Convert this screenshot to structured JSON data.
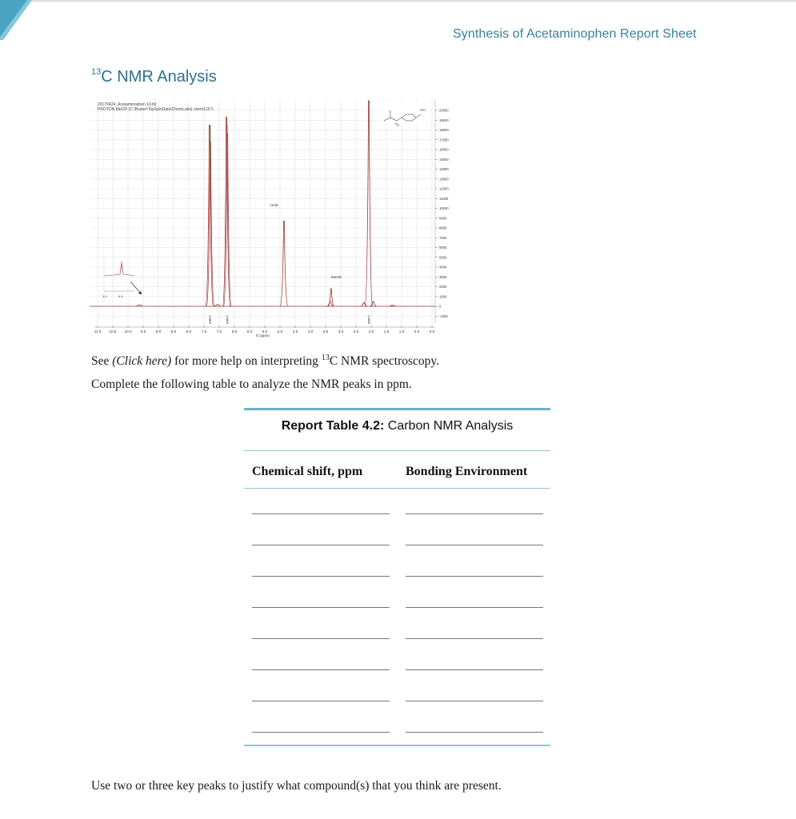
{
  "header": {
    "title": "Synthesis of Acetaminophen Report Sheet"
  },
  "section": {
    "title_sup": "13",
    "title_text": "C NMR Analysis"
  },
  "spectrum": {
    "file_line": "20170424_Acetaminophen 10.fid",
    "params_line": "PROTON MeOD {C:\\Bruker\\TopSpinData\\ChemLabs} chem129 5",
    "solvent_labels": {
      "hod": "HOD",
      "meod": "MeOD"
    },
    "structure_label": "OH",
    "structure_nh": "H",
    "inset_ticks": [
      "1.0",
      "9.5"
    ],
    "xaxis_title": "f1 (ppm)",
    "colors": {
      "trace": "#a03030",
      "integral": "#5a8a2a",
      "integral_text": "#3a3aa0",
      "grid": "#e2e2e2"
    }
  },
  "chart_data": {
    "type": "line",
    "title": "20170424_Acetaminophen 10.fid — PROTON MeOD",
    "xlabel": "f1 (ppm)",
    "ylabel": "",
    "xlim": [
      11.0,
      0.0
    ],
    "ylim": [
      -1000,
      20000
    ],
    "grid": true,
    "x_ticks": [
      "11.0",
      "10.5",
      "10.0",
      "9.5",
      "9.0",
      "8.5",
      "8.0",
      "7.5",
      "7.0",
      "6.5",
      "6.0",
      "5.5",
      "5.0",
      "4.5",
      "4.0",
      "3.5",
      "3.0",
      "2.5",
      "2.0",
      "1.5",
      "1.0",
      "0.5",
      "0.0"
    ],
    "y_ticks": [
      "20000",
      "19000",
      "18000",
      "17000",
      "16000",
      "15000",
      "14000",
      "13000",
      "12000",
      "11000",
      "10000",
      "9000",
      "8000",
      "7000",
      "6000",
      "5000",
      "4000",
      "3000",
      "2000",
      "1000",
      "0",
      "-1000"
    ],
    "peaks": [
      {
        "ppm": 9.62,
        "intensity": 150,
        "label": ""
      },
      {
        "ppm": 7.32,
        "intensity": 18500,
        "label": ""
      },
      {
        "ppm": 7.29,
        "intensity": 16800,
        "label": ""
      },
      {
        "ppm": 7.05,
        "intensity": 200,
        "label": ""
      },
      {
        "ppm": 6.76,
        "intensity": 19300,
        "label": ""
      },
      {
        "ppm": 6.73,
        "intensity": 17600,
        "label": ""
      },
      {
        "ppm": 4.87,
        "intensity": 8700,
        "label": "HOD"
      },
      {
        "ppm": 3.32,
        "intensity": 1800,
        "label": "MeOD"
      },
      {
        "ppm": 3.35,
        "intensity": 500,
        "label": ""
      },
      {
        "ppm": 2.24,
        "intensity": 400,
        "label": ""
      },
      {
        "ppm": 2.08,
        "intensity": 21000,
        "label": ""
      },
      {
        "ppm": 1.93,
        "intensity": 500,
        "label": ""
      },
      {
        "ppm": 1.3,
        "intensity": 80,
        "label": ""
      }
    ],
    "integrals": [
      {
        "ppm": 7.3,
        "value": "2.00"
      },
      {
        "ppm": 6.74,
        "value": "2.00"
      },
      {
        "ppm": 2.08,
        "value": "3.00"
      }
    ],
    "annotations": [
      "HOD",
      "MeOD"
    ]
  },
  "text": {
    "help_prefix": "See ",
    "help_link": "(Click here)",
    "help_middle": " for more help on interpreting ",
    "help_sup": "13",
    "help_suffix": "C NMR spectroscopy.",
    "instruction": "Complete the following table to analyze the NMR peaks in ppm.",
    "justify_prompt": "Use two or three key peaks to justify what compound(s) that you think are present."
  },
  "table": {
    "caption_bold": "Report Table 4.2:",
    "caption_rest": " Carbon NMR Analysis",
    "columns": [
      "Chemical shift, ppm",
      "Bonding Environment"
    ],
    "rows": [
      {
        "shift": "",
        "environment": ""
      },
      {
        "shift": "",
        "environment": ""
      },
      {
        "shift": "",
        "environment": ""
      },
      {
        "shift": "",
        "environment": ""
      },
      {
        "shift": "",
        "environment": ""
      },
      {
        "shift": "",
        "environment": ""
      },
      {
        "shift": "",
        "environment": ""
      },
      {
        "shift": "",
        "environment": ""
      }
    ]
  }
}
